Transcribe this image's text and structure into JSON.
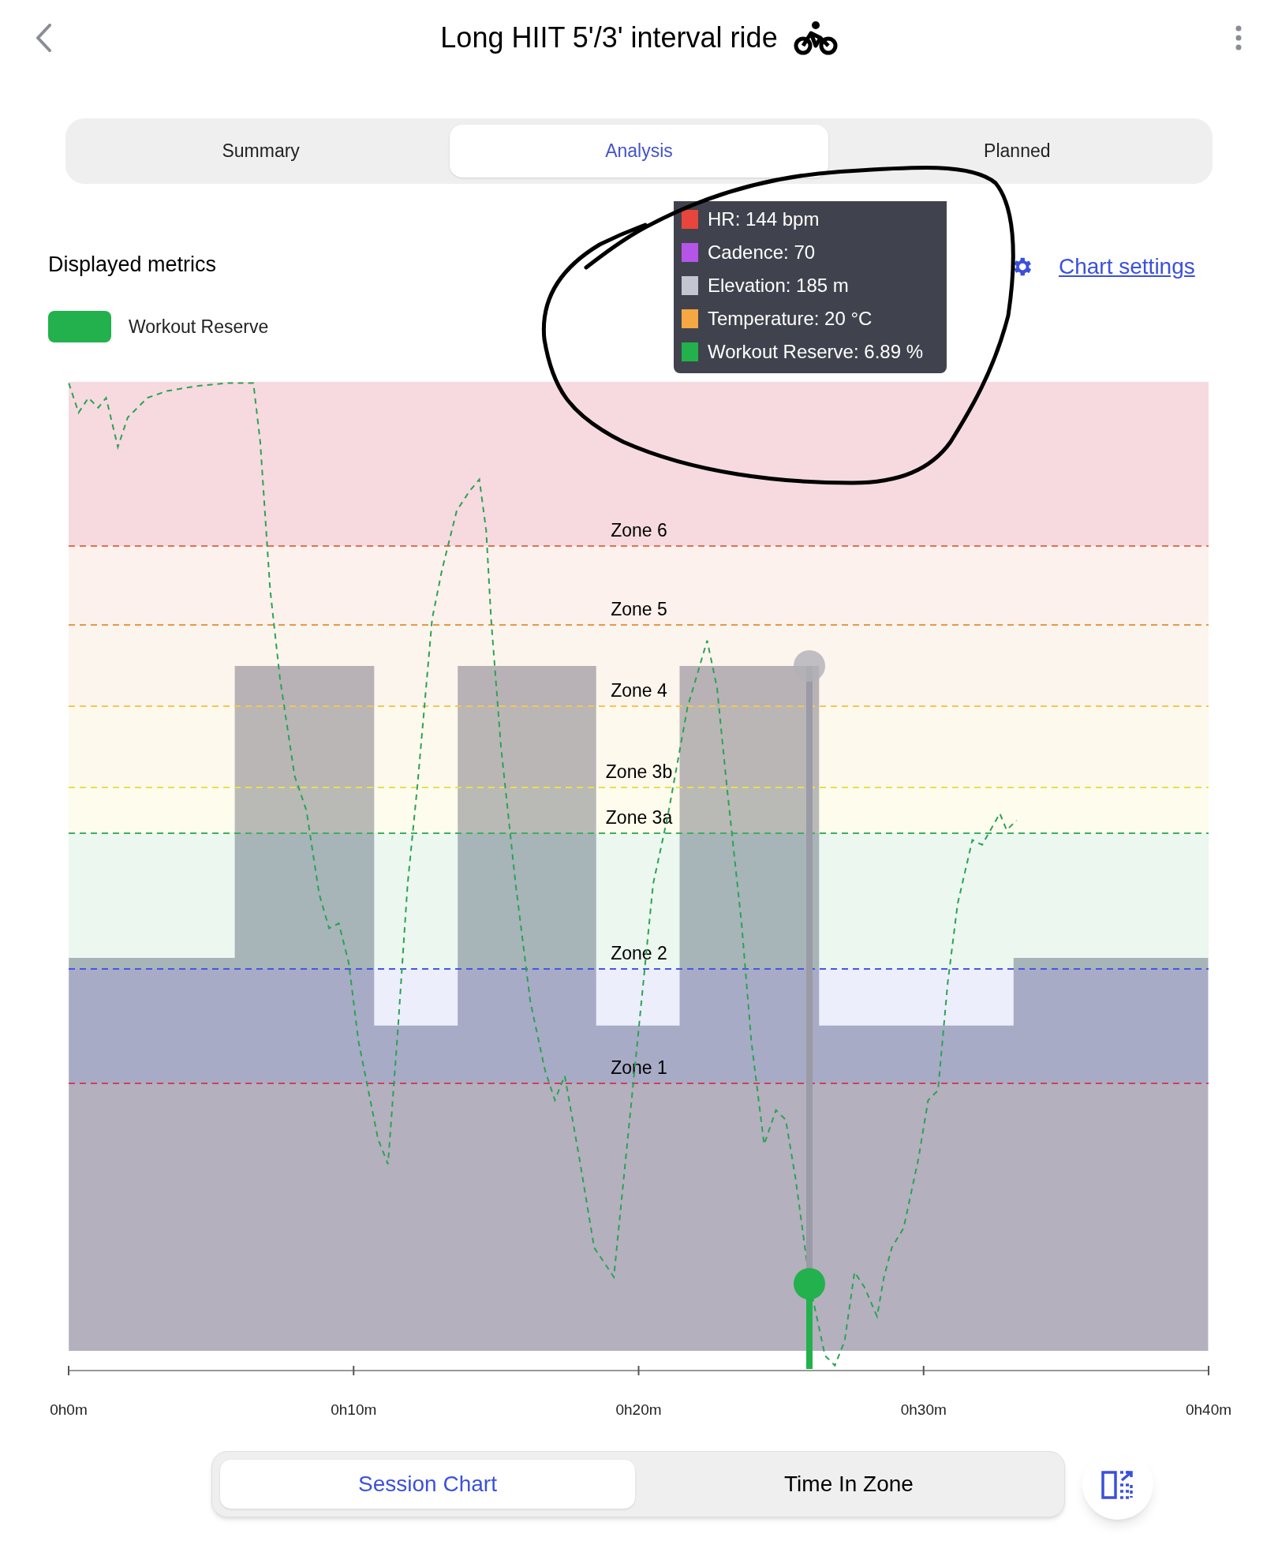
{
  "header": {
    "title": "Long HIIT 5'/3' interval ride"
  },
  "tabs": [
    {
      "label": "Summary",
      "selected": false
    },
    {
      "label": "Analysis",
      "selected": true
    },
    {
      "label": "Planned",
      "selected": false
    }
  ],
  "metrics": {
    "heading": "Displayed metrics",
    "legend": [
      {
        "label": "Workout Reserve",
        "color": "#22b14c"
      }
    ],
    "settings_link": "Chart settings"
  },
  "tooltip": [
    {
      "text": "HR: 144 bpm",
      "color": "#e8453c"
    },
    {
      "text": "Cadence: 70",
      "color": "#b455e8"
    },
    {
      "text": "Elevation: 185 m",
      "color": "#c3c6cf"
    },
    {
      "text": "Temperature: 20 °C",
      "color": "#f5a742"
    },
    {
      "text": "Workout Reserve: 6.89 %",
      "color": "#22b14c"
    }
  ],
  "zones": [
    {
      "label": "Zone 6",
      "color": "#e0714f"
    },
    {
      "label": "Zone 5",
      "color": "#e39a4a"
    },
    {
      "label": "Zone 4",
      "color": "#f2c94c"
    },
    {
      "label": "Zone 3b",
      "color": "#e9e04a"
    },
    {
      "label": "Zone 3a",
      "color": "#3fae62"
    },
    {
      "label": "Zone 2",
      "color": "#4457e6"
    },
    {
      "label": "Zone 1",
      "color": "#d0405a"
    }
  ],
  "x_ticks": [
    "0h0m",
    "0h10m",
    "0h20m",
    "0h30m",
    "0h40m"
  ],
  "view_switch": [
    {
      "label": "Session Chart",
      "selected": true
    },
    {
      "label": "Time In Zone",
      "selected": false
    }
  ]
}
